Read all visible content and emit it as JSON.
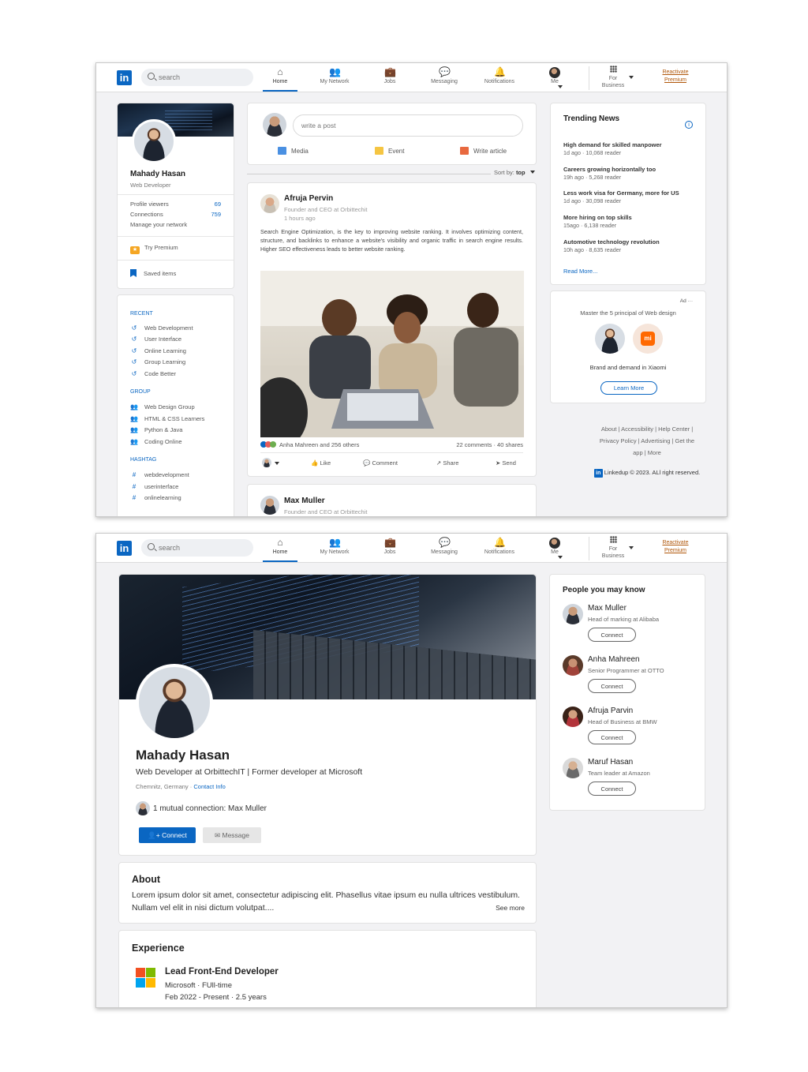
{
  "nav": {
    "search_placeholder": "search",
    "items": [
      "Home",
      "My Network",
      "Jobs",
      "Messaging",
      "Notifications",
      "Me"
    ],
    "for_business": [
      "For",
      "Business"
    ],
    "premium": [
      "Reactivate",
      "Premium"
    ]
  },
  "profile_card": {
    "name": "Mahady Hasan",
    "title": "Web Developer",
    "stats": [
      {
        "label": "Profile viewers",
        "value": "69"
      },
      {
        "label": "Connections",
        "value": "759"
      }
    ],
    "manage": "Manage your network",
    "try_premium": "Try Premium",
    "saved_items": "Saved items"
  },
  "sidebar": {
    "recent_head": "RECENT",
    "recent": [
      "Web Development",
      "User Interface",
      "Online Learning",
      "Group Learning",
      "Code Better"
    ],
    "group_head": "GROUP",
    "groups": [
      "Web Design Group",
      "HTML & CSS Learners",
      "Python & Java",
      "Coding Online"
    ],
    "hashtag_head": "HASHTAG",
    "hashtags": [
      "webdevelopment",
      "userinterface",
      "onlinelearning"
    ]
  },
  "composer": {
    "placeholder": "write a post",
    "actions": [
      "Media",
      "Event",
      "Write article"
    ],
    "sort_label": "Sort by:",
    "sort_value": "top"
  },
  "post": {
    "author": "Afruja Pervin",
    "headline": "Founder and CEO at Orbittechit",
    "time": "1 hours ago",
    "text": "Search Engine Optimization, is the key to improving website ranking. It involves optimizing content, structure, and backlinks to enhance a website's visibility and organic traffic in search engine results. Higher SEO effectiveness leads to better website ranking.",
    "reactions": "Anha Mahreen and 256 others",
    "counts": "22 comments · 40 shares",
    "actions": [
      "Like",
      "Comment",
      "Share",
      "Send"
    ]
  },
  "post2": {
    "author": "Max Muller",
    "headline": "Founder and CEO at Orbittechit"
  },
  "trending": {
    "title": "Trending News",
    "items": [
      {
        "headline": "High demand for skilled manpower",
        "meta": "1d ago · 10,068 reader"
      },
      {
        "headline": "Careers growing horizontally too",
        "meta": "19h ago · 5,268 reader"
      },
      {
        "headline": "Less work visa for Germany, more for US",
        "meta": "1d ago · 30,098 reader"
      },
      {
        "headline": "More hiring on top skills",
        "meta": "15ago · 6,138 reader"
      },
      {
        "headline": "Automotive technology revolution",
        "meta": "10h ago · 8,635 reader"
      }
    ],
    "read_more": "Read More..."
  },
  "ad": {
    "tag": "Ad",
    "title": "Master the 5 principal of Web design",
    "logo_text": "mi",
    "caption": "Brand and demand in Xiaomi",
    "button": "Learn More"
  },
  "footer": {
    "line1": "About | Accessibility | Help Center |",
    "line2": "Privacy Policy | Advertising | Get the",
    "line3": "app | More",
    "brand_logo": "in",
    "copyright": "Linkedup © 2023. ALl right reserved."
  },
  "profile": {
    "name": "Mahady Hasan",
    "headline": "Web Developer at OrbittechIT | Former developer at Microsoft",
    "location": "Chemnitz, Germany ·",
    "contact": "Contact Info",
    "mutual": "1 mutual connection: Max Muller",
    "connect": "Connect",
    "message": "Message"
  },
  "about": {
    "title": "About",
    "text": "Lorem ipsum dolor sit amet, consectetur adipiscing elit. Phasellus vitae ipsum eu nulla ultrices vestibulum. Nullam vel elit in nisi dictum volutpat....",
    "see_more": "See more"
  },
  "experience": {
    "title": "Experience",
    "role": "Lead Front-End Developer",
    "company": "Microsoft · FUll-time",
    "dates": "Feb 2022 - Present · 2.5 years"
  },
  "pymk": {
    "title": "People you may know",
    "people": [
      {
        "name": "Max Muller",
        "role": "Head of marking at Alibaba"
      },
      {
        "name": "Anha Mahreen",
        "role": "Senior Programmer at OTTO"
      },
      {
        "name": "Afruja Parvin",
        "role": "Head of Business at BMW"
      },
      {
        "name": "Maruf Hasan",
        "role": "Team leader at Amazon"
      }
    ],
    "connect": "Connect"
  },
  "colors": {
    "brand": "#0a66c2",
    "premium": "#b0570a",
    "ad_logo": "#ff6900"
  }
}
